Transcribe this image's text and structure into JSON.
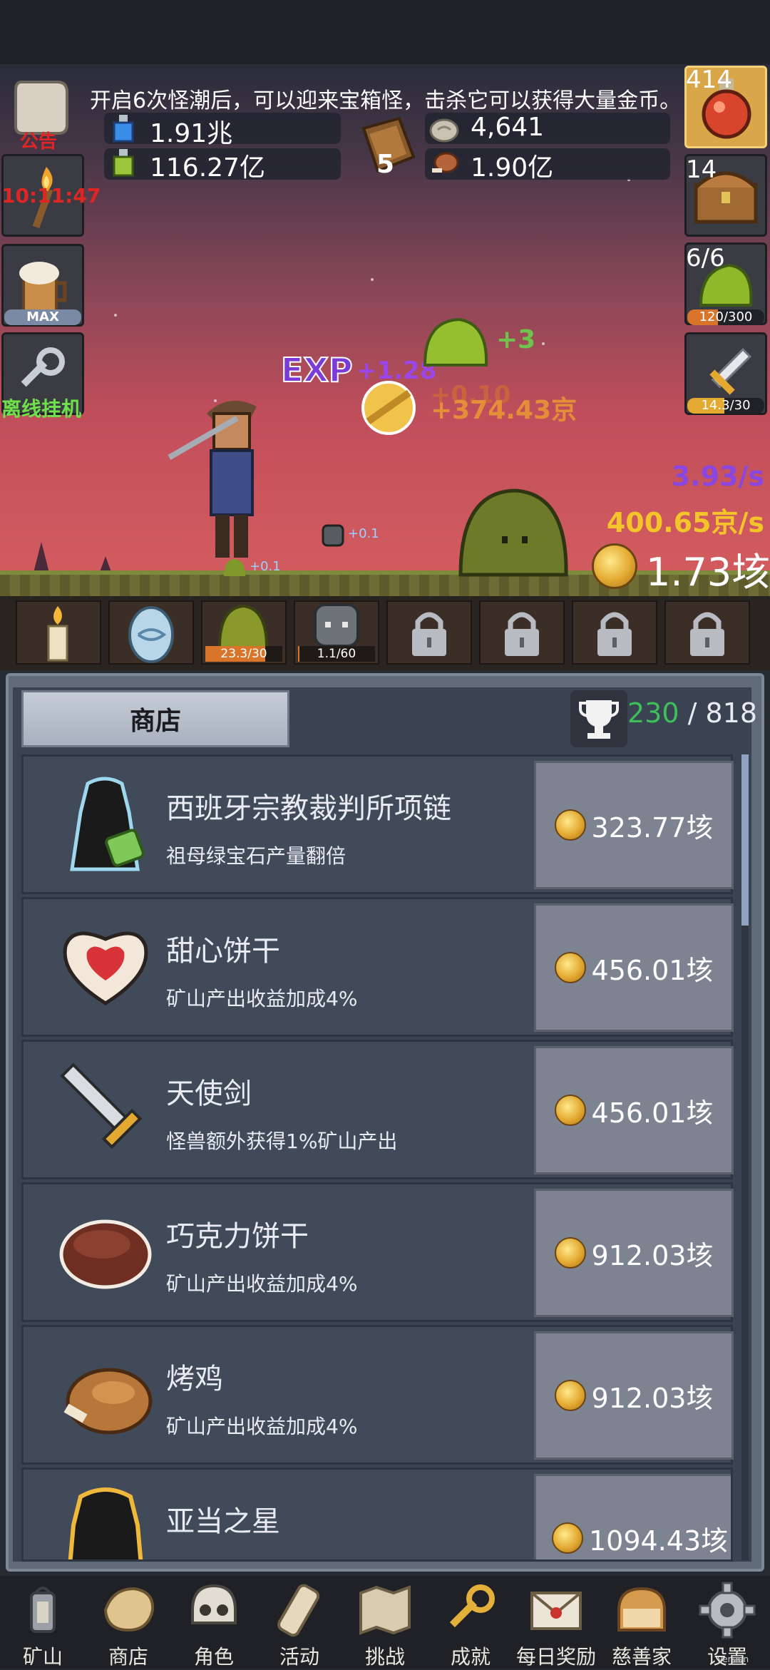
{
  "notice": "开启6次怪潮后，可以迎来宝箱怪，击杀它可以获得大量金币。",
  "left_buttons": {
    "announcement_label": "公告",
    "torch_timer": "10:11:47",
    "beer_badge": "MAX",
    "offline_label": "离线挂机"
  },
  "right_buttons": {
    "potion_count": "414",
    "chest_count": "14",
    "slime_count": "6/6",
    "slime_progress": "120/300",
    "slime_progress_fraction": 0.4,
    "sword_progress": "14.3/30",
    "sword_progress_fraction": 0.48
  },
  "resources": {
    "blue_potion": "1.91兆",
    "green_potion": "116.27亿",
    "book_count": "5",
    "stone": "4,641",
    "meat": "1.90亿"
  },
  "battle": {
    "exp_label": "EXP",
    "exp_gain": "+1.28",
    "slime_gain": "+3",
    "gold_gain": "+374.43京",
    "gold_gain_ghost": "+0.10",
    "small_gain_1": "+0.1",
    "small_gain_2": "+0.1",
    "exp_rate": "3.93/s",
    "gold_rate": "400.65京/s",
    "gold_total": "1.73垓"
  },
  "slots": [
    {
      "name": "candle"
    },
    {
      "name": "egg"
    },
    {
      "name": "slime",
      "progress": "23.3/30",
      "fraction": 0.78
    },
    {
      "name": "zombie",
      "progress": "1.1/60",
      "fraction": 0.02
    },
    {
      "name": "locked"
    },
    {
      "name": "locked"
    },
    {
      "name": "locked"
    },
    {
      "name": "locked"
    }
  ],
  "shop": {
    "tab_label": "商店",
    "trophy_current": "230",
    "trophy_total": " / 818",
    "items": [
      {
        "title": "西班牙宗教裁判所项链",
        "desc": "祖母绿宝石产量翻倍",
        "price": "323.77垓"
      },
      {
        "title": "甜心饼干",
        "desc": "矿山产出收益加成4%",
        "price": "456.01垓"
      },
      {
        "title": "天使剑",
        "desc": "怪兽额外获得1%矿山产出",
        "price": "456.01垓"
      },
      {
        "title": "巧克力饼干",
        "desc": "矿山产出收益加成4%",
        "price": "912.03垓"
      },
      {
        "title": "烤鸡",
        "desc": "矿山产出收益加成4%",
        "price": "912.03垓"
      },
      {
        "title": "亚当之星",
        "desc": "",
        "price": "1094.43垓"
      }
    ]
  },
  "nav": [
    "矿山",
    "商店",
    "角色",
    "活动",
    "挑战",
    "成就",
    "每日奖励",
    "慈善家",
    "设置"
  ],
  "version_label": "Version"
}
